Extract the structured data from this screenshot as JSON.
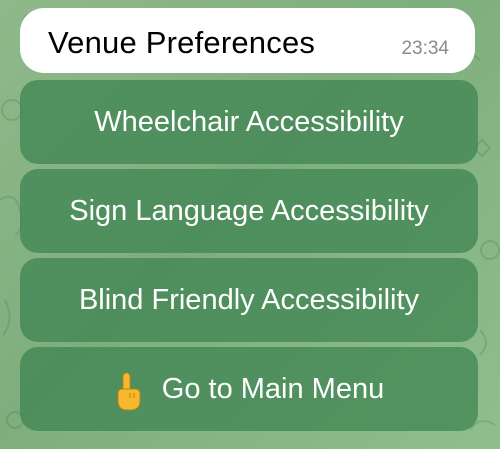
{
  "message": {
    "text": "Venue Preferences",
    "time": "23:34"
  },
  "keyboard": {
    "buttons": [
      {
        "label": "Wheelchair Accessibility"
      },
      {
        "label": "Sign Language Accessibility"
      },
      {
        "label": "Blind Friendly Accessibility"
      },
      {
        "label": "Go to Main Menu",
        "icon": "pointing-hand-icon"
      }
    ]
  },
  "colors": {
    "button_bg": "#3c8250",
    "bubble_bg": "#ffffff",
    "wallpaper": "#86b684"
  }
}
